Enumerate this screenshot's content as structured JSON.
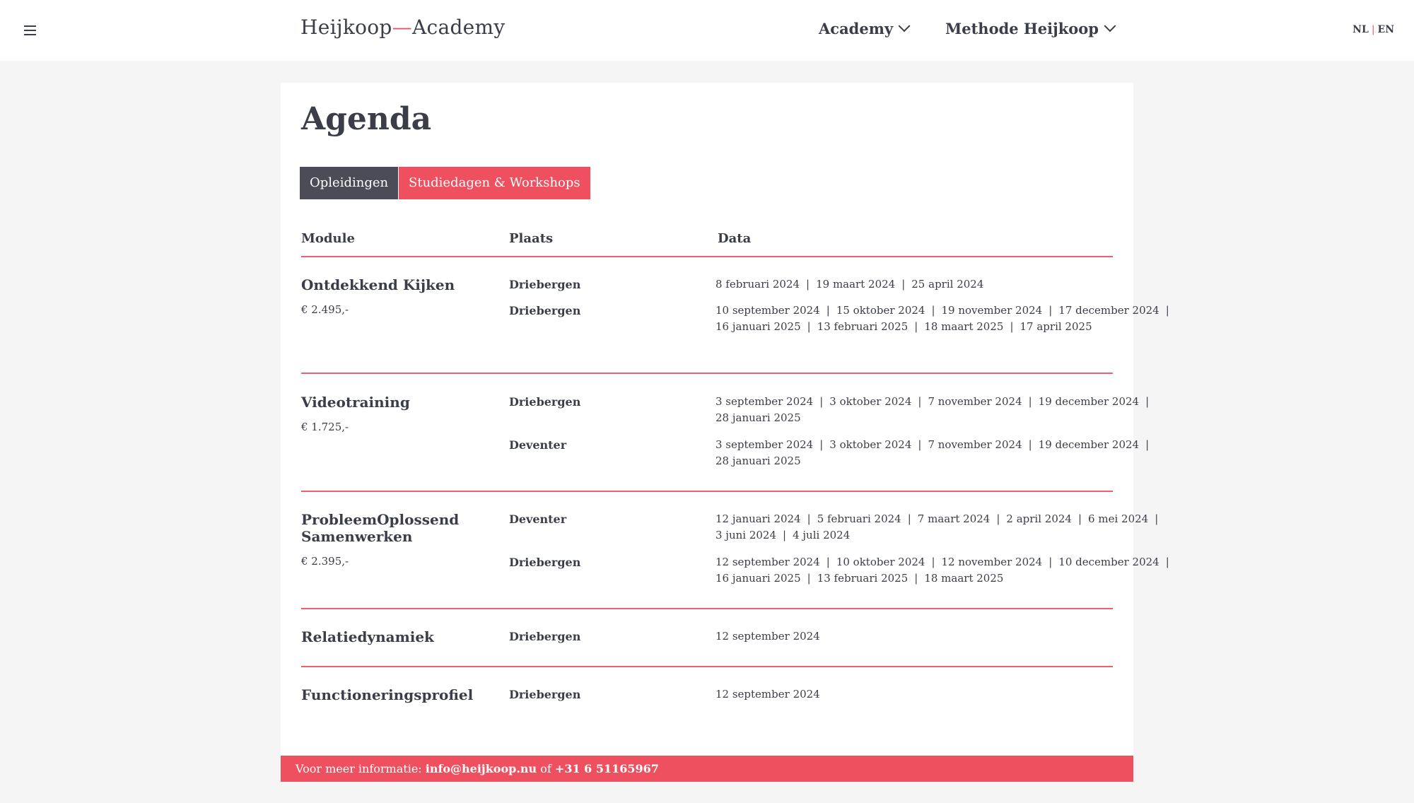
{
  "header": {
    "logo_left": "Heijkoop",
    "logo_dash": "—",
    "logo_right": "Academy",
    "nav": [
      "Academy",
      "Methode Heijkoop"
    ],
    "lang_nl": "NL",
    "lang_sep": "|",
    "lang_en": "EN"
  },
  "page": {
    "title": "Agenda",
    "tabs": [
      "Opleidingen",
      "Studiedagen & Workshops"
    ]
  },
  "table": {
    "headers": [
      "Module",
      "Plaats",
      "Data"
    ],
    "rows": [
      {
        "title": "Ontdekkend Kijken",
        "price": "€ 2.495,-",
        "places": [
          {
            "place": "Driebergen",
            "dates": [
              "8 februari 2024",
              "19 maart 2024",
              "25 april 2024"
            ]
          },
          {
            "place": "Driebergen",
            "dates": [
              "10 september 2024",
              "15 oktober 2024",
              "19 november 2024",
              "17 december 2024",
              "16 januari 2025",
              "13 februari 2025",
              "18 maart 2025",
              "17 april 2025"
            ]
          }
        ]
      },
      {
        "title": "Videotraining",
        "price": "€ 1.725,-",
        "places": [
          {
            "place": "Driebergen",
            "dates": [
              "3 september 2024",
              "3 oktober 2024",
              "7 november 2024",
              "19 december 2024",
              "28 januari 2025"
            ]
          },
          {
            "place": "Deventer",
            "dates": [
              "3 september 2024",
              "3 oktober 2024",
              "7 november 2024",
              "19 december 2024",
              "28 januari 2025"
            ]
          }
        ]
      },
      {
        "title": "ProbleemOplossend Samenwerken",
        "price": "€ 2.395,-",
        "places": [
          {
            "place": "Deventer",
            "dates": [
              "12 januari 2024",
              "5 februari 2024",
              "7 maart 2024",
              "2 april 2024",
              "6 mei 2024",
              "3 juni 2024",
              "4 juli 2024"
            ]
          },
          {
            "place": "Driebergen",
            "dates": [
              "12 september 2024",
              "10 oktober 2024",
              "12 november 2024",
              "10 december 2024",
              "16 januari 2025",
              "13 februari 2025",
              "18 maart 2025"
            ]
          }
        ]
      },
      {
        "title": "Relatiedynamiek",
        "price": "",
        "places": [
          {
            "place": "Driebergen",
            "dates": [
              "12 september 2024"
            ]
          }
        ]
      },
      {
        "title": "Functioneringsprofiel",
        "price": "",
        "places": [
          {
            "place": "Driebergen",
            "dates": [
              "12 september 2024"
            ]
          }
        ]
      }
    ]
  },
  "footer": {
    "prefix": "Voor meer informatie: ",
    "email": "info@heijkoop.nu",
    "middle": " of ",
    "phone": "+31 6 51165967"
  }
}
